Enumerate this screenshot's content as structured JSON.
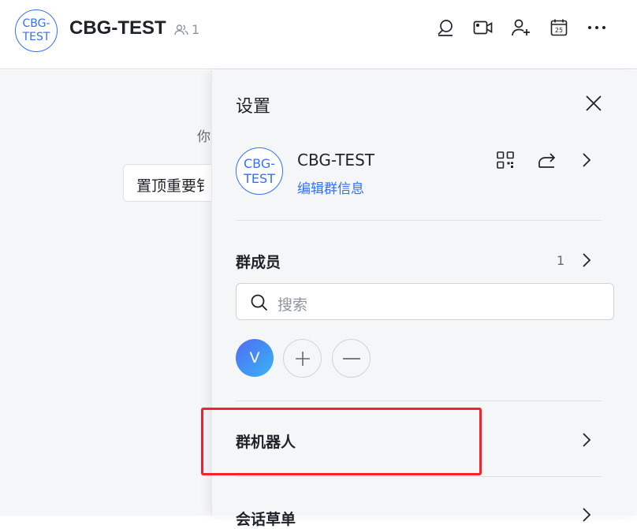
{
  "header": {
    "group_avatar": [
      "CBG-",
      "TEST"
    ],
    "title": "CBG-TEST",
    "member_count": "1",
    "icons": [
      "search-icon",
      "video-call-icon",
      "add-member-icon",
      "calendar-icon",
      "more-icon"
    ],
    "calendar_day": "25"
  },
  "chat": {
    "hint": "你",
    "pin_card": "置顶重要钅"
  },
  "settings": {
    "title": "设置",
    "group": {
      "avatar": [
        "CBG-",
        "TEST"
      ],
      "name": "CBG-TEST",
      "edit_link": "编辑群信息"
    },
    "members": {
      "title": "群成员",
      "count": "1",
      "search_placeholder": "搜索",
      "member_initial": "V"
    },
    "bot_section": "群机器人",
    "next_section_partial": "会话草单"
  },
  "colors": {
    "accent": "#3370ff",
    "highlight": "#f5222d",
    "drawer_bg": "#f5f6f7"
  }
}
